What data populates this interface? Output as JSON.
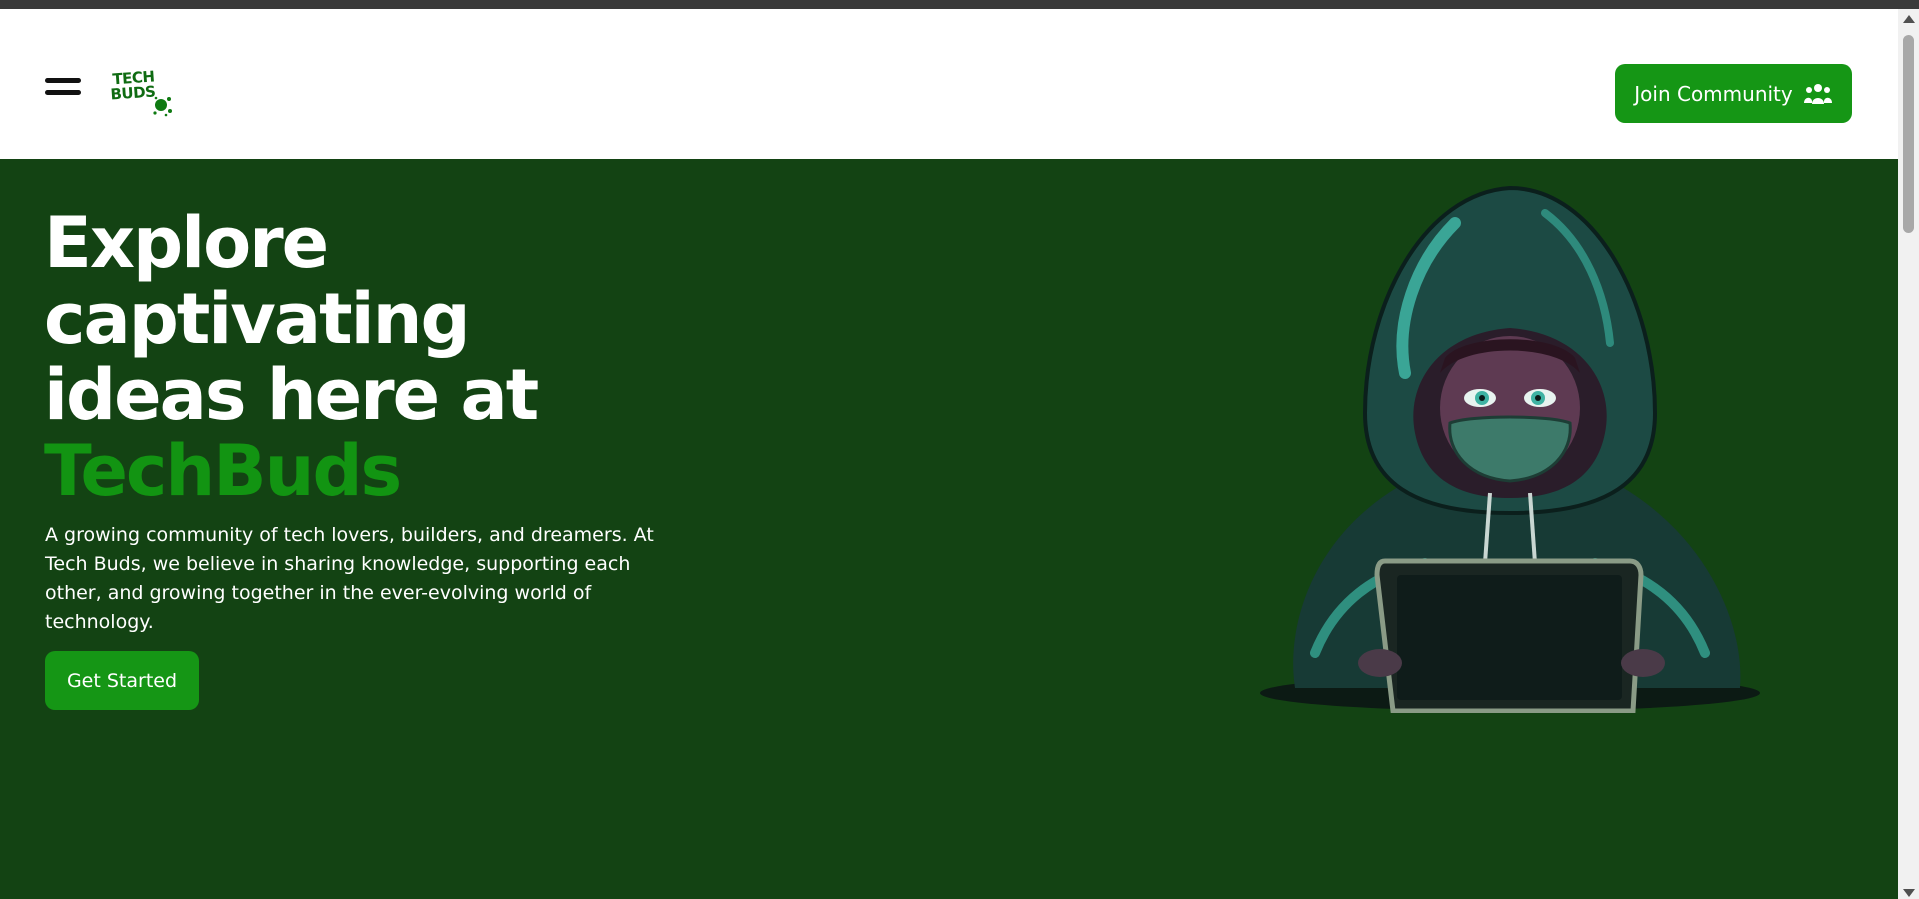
{
  "header": {
    "logo_text_line1": "TECH",
    "logo_text_line2": "BUDS",
    "join_button_label": "Join Community",
    "join_icon": "users-icon"
  },
  "hero": {
    "headline_line1": "Explore",
    "headline_line2": "captivating",
    "headline_line3": "ideas here at",
    "headline_accent": "TechBuds",
    "description": "A growing community of tech lovers, builders, and dreamers. At Tech Buds, we believe in sharing knowledge, supporting each other, and growing together in the ever-evolving world of technology.",
    "cta_label": "Get Started",
    "illustration": "hooded-coder-illustration"
  },
  "colors": {
    "brand_green": "#159615",
    "hero_background": "#134313",
    "accent_text": "#129412"
  }
}
